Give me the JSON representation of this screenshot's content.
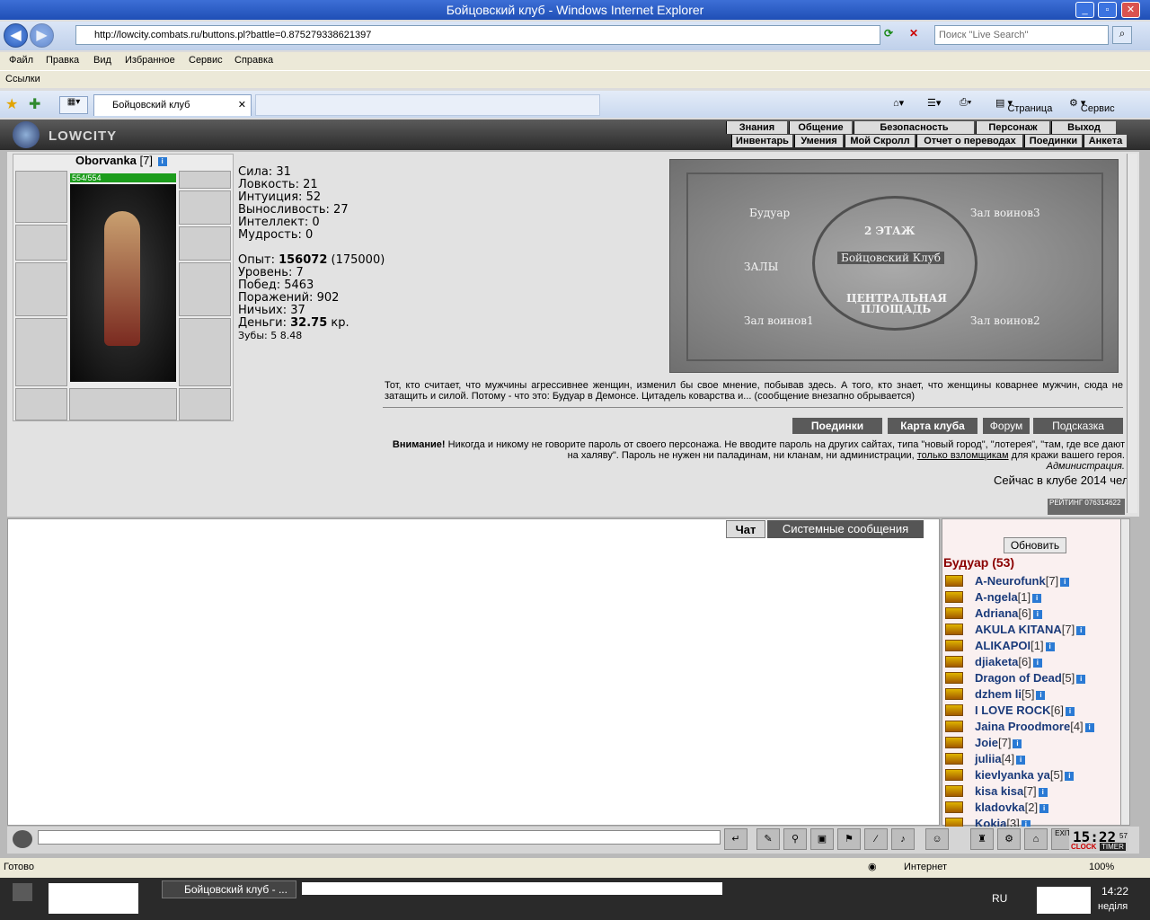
{
  "window": {
    "title": "Бойцовский клуб - Windows Internet Explorer"
  },
  "browser": {
    "address": "http://lowcity.combats.ru/buttons.pl?battle=0.875279338621397",
    "search_placeholder": "Поиск \"Live Search\"",
    "menu": [
      "Файл",
      "Правка",
      "Вид",
      "Избранное",
      "Сервис",
      "Справка"
    ],
    "links_label": "Ссылки",
    "tab_title": "Бойцовский клуб",
    "page_menu": "Страница",
    "tools_menu": "Сервис",
    "status": "Готово",
    "zone": "Интернет",
    "zoom": "100%"
  },
  "game": {
    "logo": "LOWCITY",
    "nav_top": [
      "Знания",
      "Общение",
      "Безопасность",
      "Персонаж",
      "Выход"
    ],
    "nav_bottom": [
      "Инвентарь",
      "Умения",
      "Мой Скролл",
      "Отчет о переводах",
      "Поединки",
      "Анкета"
    ],
    "character": {
      "name": "Oborvanka",
      "level": "[7]",
      "hp": "554/554"
    },
    "stats": [
      "Сила: 31",
      "Ловкость: 21",
      "Интуиция: 52",
      "Выносливость: 27",
      "Интеллект: 0",
      "Мудрость: 0"
    ],
    "experience": {
      "label": "Опыт:",
      "value": "156072",
      "next": "(175000)"
    },
    "info": [
      "Уровень: 7",
      "Побед: 5463",
      "Поражений: 902",
      "Ничьих: 37"
    ],
    "money": {
      "label": "Деньги:",
      "value": "32.75",
      "unit": "кр."
    },
    "teeth": {
      "label": "Зубы:",
      "value": "5 8.48"
    },
    "map": {
      "labels": [
        "Будуар",
        "2 ЭТАЖ",
        "Зал воинов3",
        "Бойцовский Клуб",
        "ЗАЛЫ",
        "ЦЕНТРАЛЬНАЯ ПЛОЩАДЬ",
        "Зал воинов1",
        "Зал воинов2"
      ]
    },
    "description": "Тот, кто считает, что мужчины агрессивнее женщин, изменил бы свое мнение, побывав здесь. А того, кто знает, что женщины коварнее мужчин, сюда не затащить и силой. Потому - что это: Будуар в Демонсе. Цитадель коварства и... (сообщение внезапно обрывается)",
    "buttons": [
      "Поединки",
      "Карта клуба",
      "Форум",
      "Подсказка"
    ],
    "warning_title": "Внимание!",
    "warning_text": "Никогда и никому не говорите пароль от своего персонажа. Не вводите пароль на других сайтах, типа \"новый город\", \"лотерея\", \"там, где все дают на халяву\". Пароль не нужен ни паладинам, ни кланам, ни администрации,",
    "warning_link": "только взломщикам",
    "warning_end": "для кражи вашего героя.",
    "warning_sign": "Администрация.",
    "online": "Сейчас в клубе 2014 чел.",
    "rating": "РЕЙТИНГ 076314622"
  },
  "chat": {
    "tabs": [
      "Чат",
      "Системные сообщения"
    ],
    "refresh": "Обновить",
    "room": "Будуар (53)",
    "users": [
      {
        "name": "A-Neurofunk",
        "level": "[7]"
      },
      {
        "name": "A-ngela",
        "level": "[1]"
      },
      {
        "name": "Adriana",
        "level": "[6]"
      },
      {
        "name": "AKULA KITANA",
        "level": "[7]"
      },
      {
        "name": "ALIKAPOI",
        "level": "[1]"
      },
      {
        "name": "djiaketa",
        "level": "[6]"
      },
      {
        "name": "Dragon of Dead",
        "level": "[5]"
      },
      {
        "name": "dzhem li",
        "level": "[5]"
      },
      {
        "name": "I LOVE ROCK",
        "level": "[6]"
      },
      {
        "name": "Jaina Proodmore",
        "level": "[4]"
      },
      {
        "name": "Joie",
        "level": "[7]"
      },
      {
        "name": "juliia",
        "level": "[4]"
      },
      {
        "name": "kievlyanka ya",
        "level": "[5]"
      },
      {
        "name": "kisa kisa",
        "level": "[7]"
      },
      {
        "name": "kladovka",
        "level": "[2]"
      },
      {
        "name": "Kokia",
        "level": "[3]"
      }
    ],
    "clock": "15:22",
    "clock_sec": "57",
    "clock_labels": [
      "CLOCK",
      "TIMER"
    ],
    "exit": "EXIT"
  },
  "taskbar": {
    "task": "Бойцовский клуб - ...",
    "lang": "RU",
    "time": "14:22",
    "day": "неділя"
  }
}
